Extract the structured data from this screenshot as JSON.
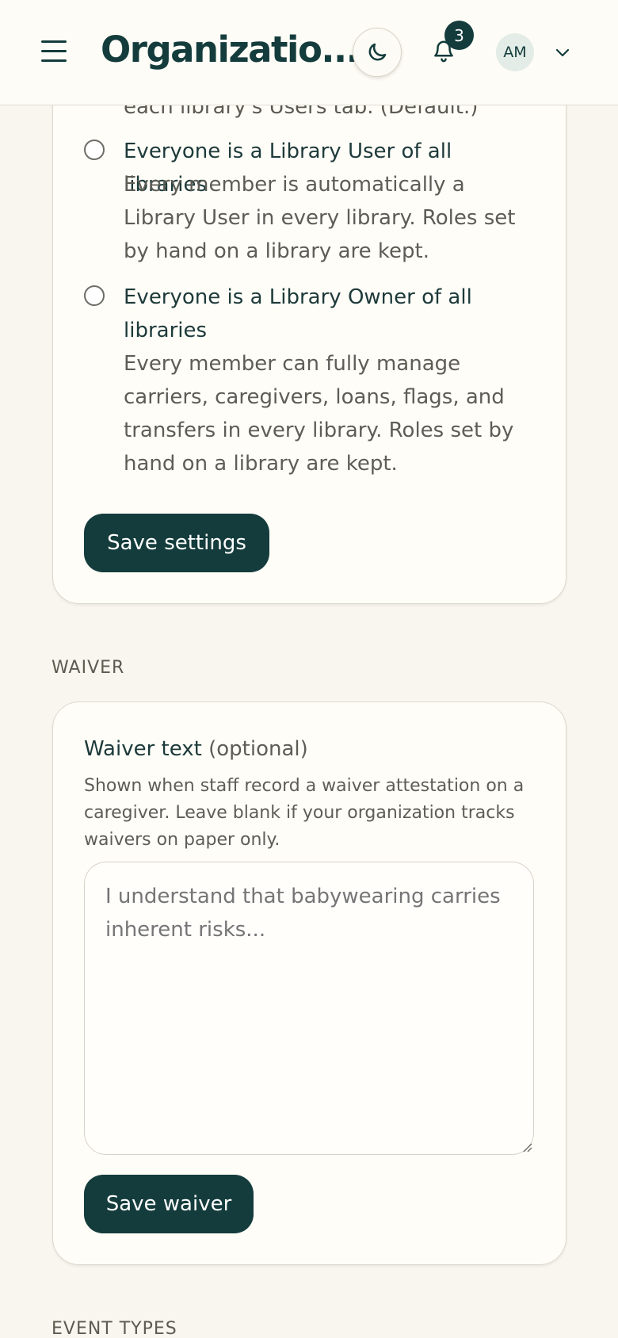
{
  "header": {
    "title": "Organizatio...",
    "notification_count": "3",
    "avatar_initials": "AM"
  },
  "membership": {
    "cut_text": "each library's Users tab. (Default.)",
    "options": [
      {
        "title": "Everyone is a Library User of all libraries",
        "desc": "Every member is automatically a Library User in every library. Roles set by hand on a library are kept.",
        "selected": false
      },
      {
        "title": "Everyone is a Library Owner of all libraries",
        "desc": "Every member can fully manage carriers, caregivers, loans, flags, and transfers in every library. Roles set by hand on a library are kept.",
        "selected": false
      }
    ],
    "save_label": "Save settings"
  },
  "waiver": {
    "section_label": "WAIVER",
    "field_label": "Waiver text",
    "field_optional": "(optional)",
    "help": "Shown when staff record a waiver attestation on a caregiver. Leave blank if your organization tracks waivers on paper only.",
    "placeholder": "I understand that babywearing carries inherent risks...",
    "save_label": "Save waiver"
  },
  "event_types": {
    "section_label": "EVENT TYPES"
  },
  "colors": {
    "primary": "#143c3c",
    "background": "#f8f6ef",
    "card": "#fffdf8"
  }
}
